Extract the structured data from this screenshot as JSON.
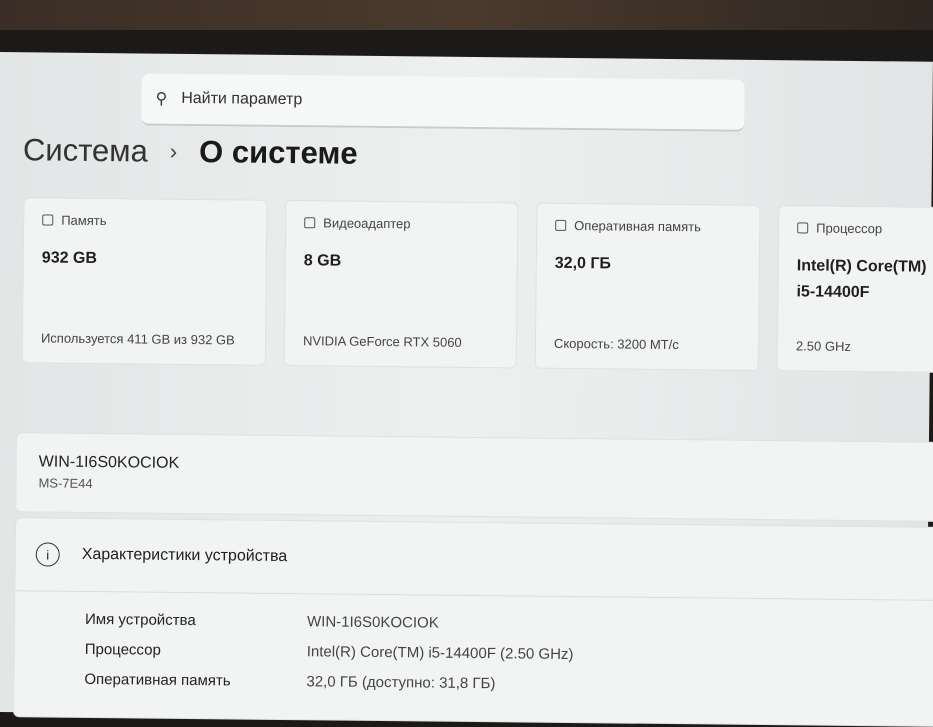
{
  "search": {
    "placeholder": "Найти параметр",
    "icon": "search-icon"
  },
  "breadcrumb": {
    "parent": "Система",
    "separator": "›",
    "current": "О системе"
  },
  "cards": [
    {
      "label": "Память",
      "value": "932 GB",
      "sub": "Используется 411 GB из 932 GB"
    },
    {
      "label": "Видеоадаптер",
      "value": "8 GB",
      "sub": "NVIDIA GeForce RTX 5060"
    },
    {
      "label": "Оперативная память",
      "value": "32,0 ГБ",
      "sub": "Скорость: 3200 МТ/с"
    },
    {
      "label": "Процессор",
      "value": "Intel(R) Core(TM) i5-14400F",
      "sub": "2.50 GHz"
    }
  ],
  "device": {
    "name": "WIN-1I6S0KOCIOK",
    "model": "MS-7E44"
  },
  "specs": {
    "title": "Характеристики устройства",
    "rows": [
      {
        "key": "Имя устройства",
        "value": "WIN-1I6S0KOCIOK"
      },
      {
        "key": "Процессор",
        "value": "Intel(R) Core(TM) i5-14400F (2.50 GHz)"
      },
      {
        "key": "Оперативная память",
        "value": "32,0 ГБ (доступно: 31,8 ГБ)"
      }
    ]
  }
}
